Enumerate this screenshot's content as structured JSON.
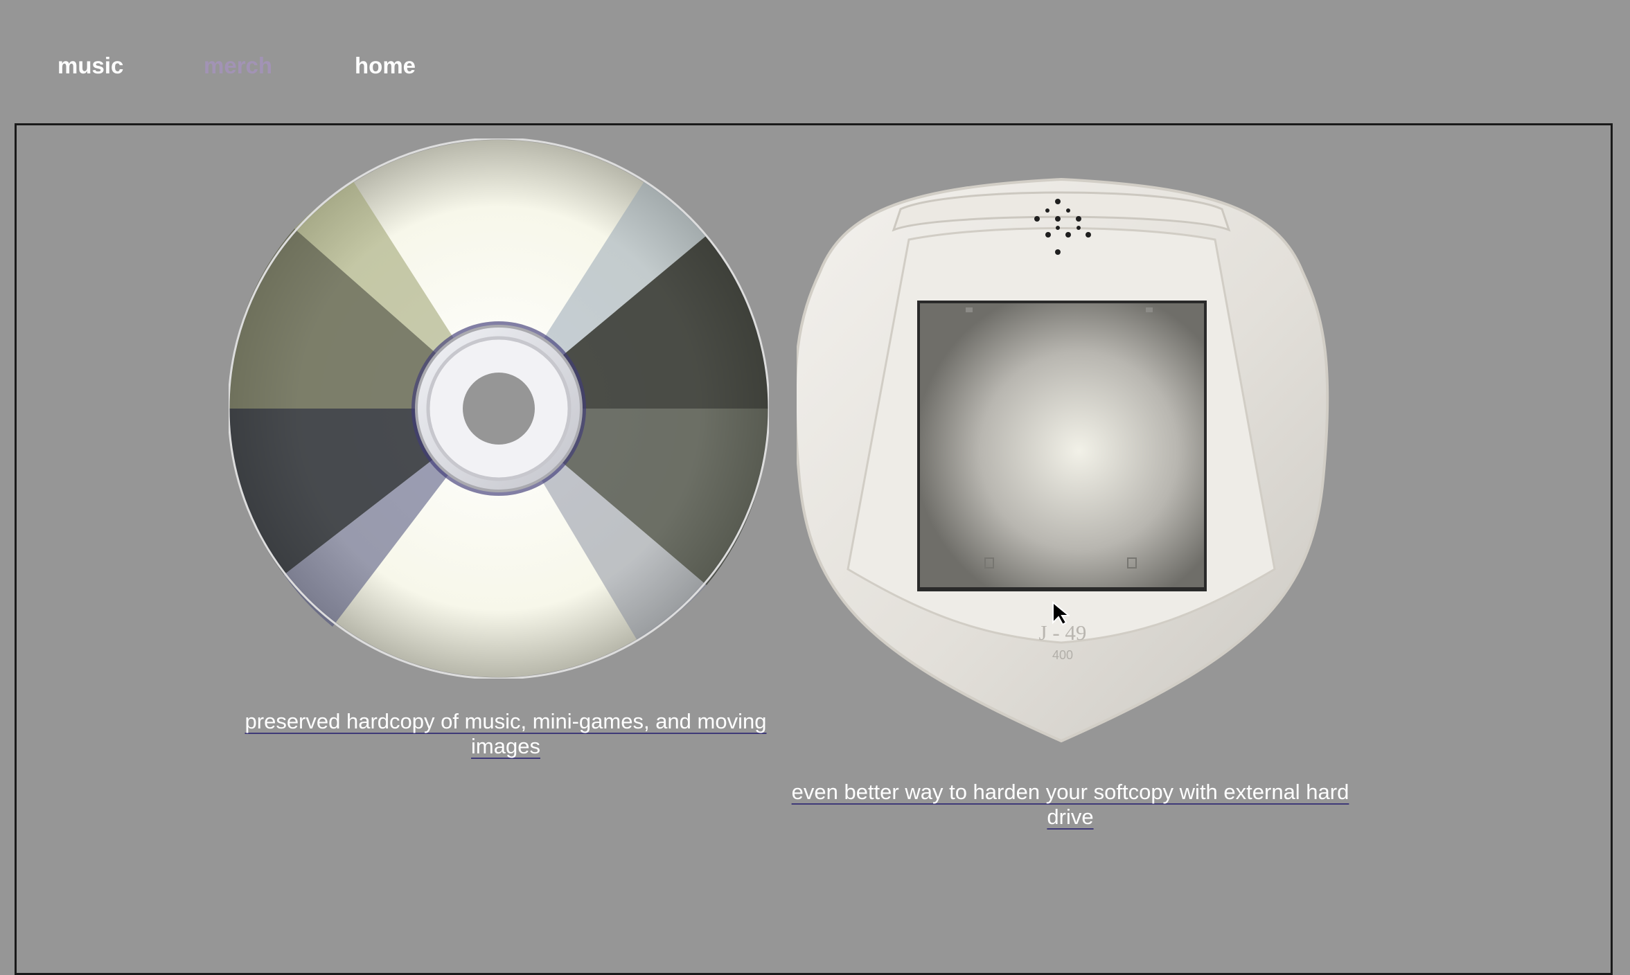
{
  "nav": {
    "music_label": "music",
    "merch_label": "merch",
    "home_label": "home"
  },
  "products": {
    "cd": {
      "caption": "preserved hardcopy of music, mini-games, and moving images"
    },
    "drive": {
      "caption": "even better way to harden your softcopy with external hard drive",
      "model_label": "J - 49",
      "capacity_label": "400"
    }
  },
  "colors": {
    "background": "#969696",
    "frame_border": "#1a1a1a",
    "link_underline": "#3f3a78",
    "merch_link": "#a293b5",
    "text": "#ffffff"
  },
  "icons": {
    "cursor": "arrow-cursor-icon",
    "cd": "compact-disc-image",
    "drive": "external-hard-drive-image"
  }
}
